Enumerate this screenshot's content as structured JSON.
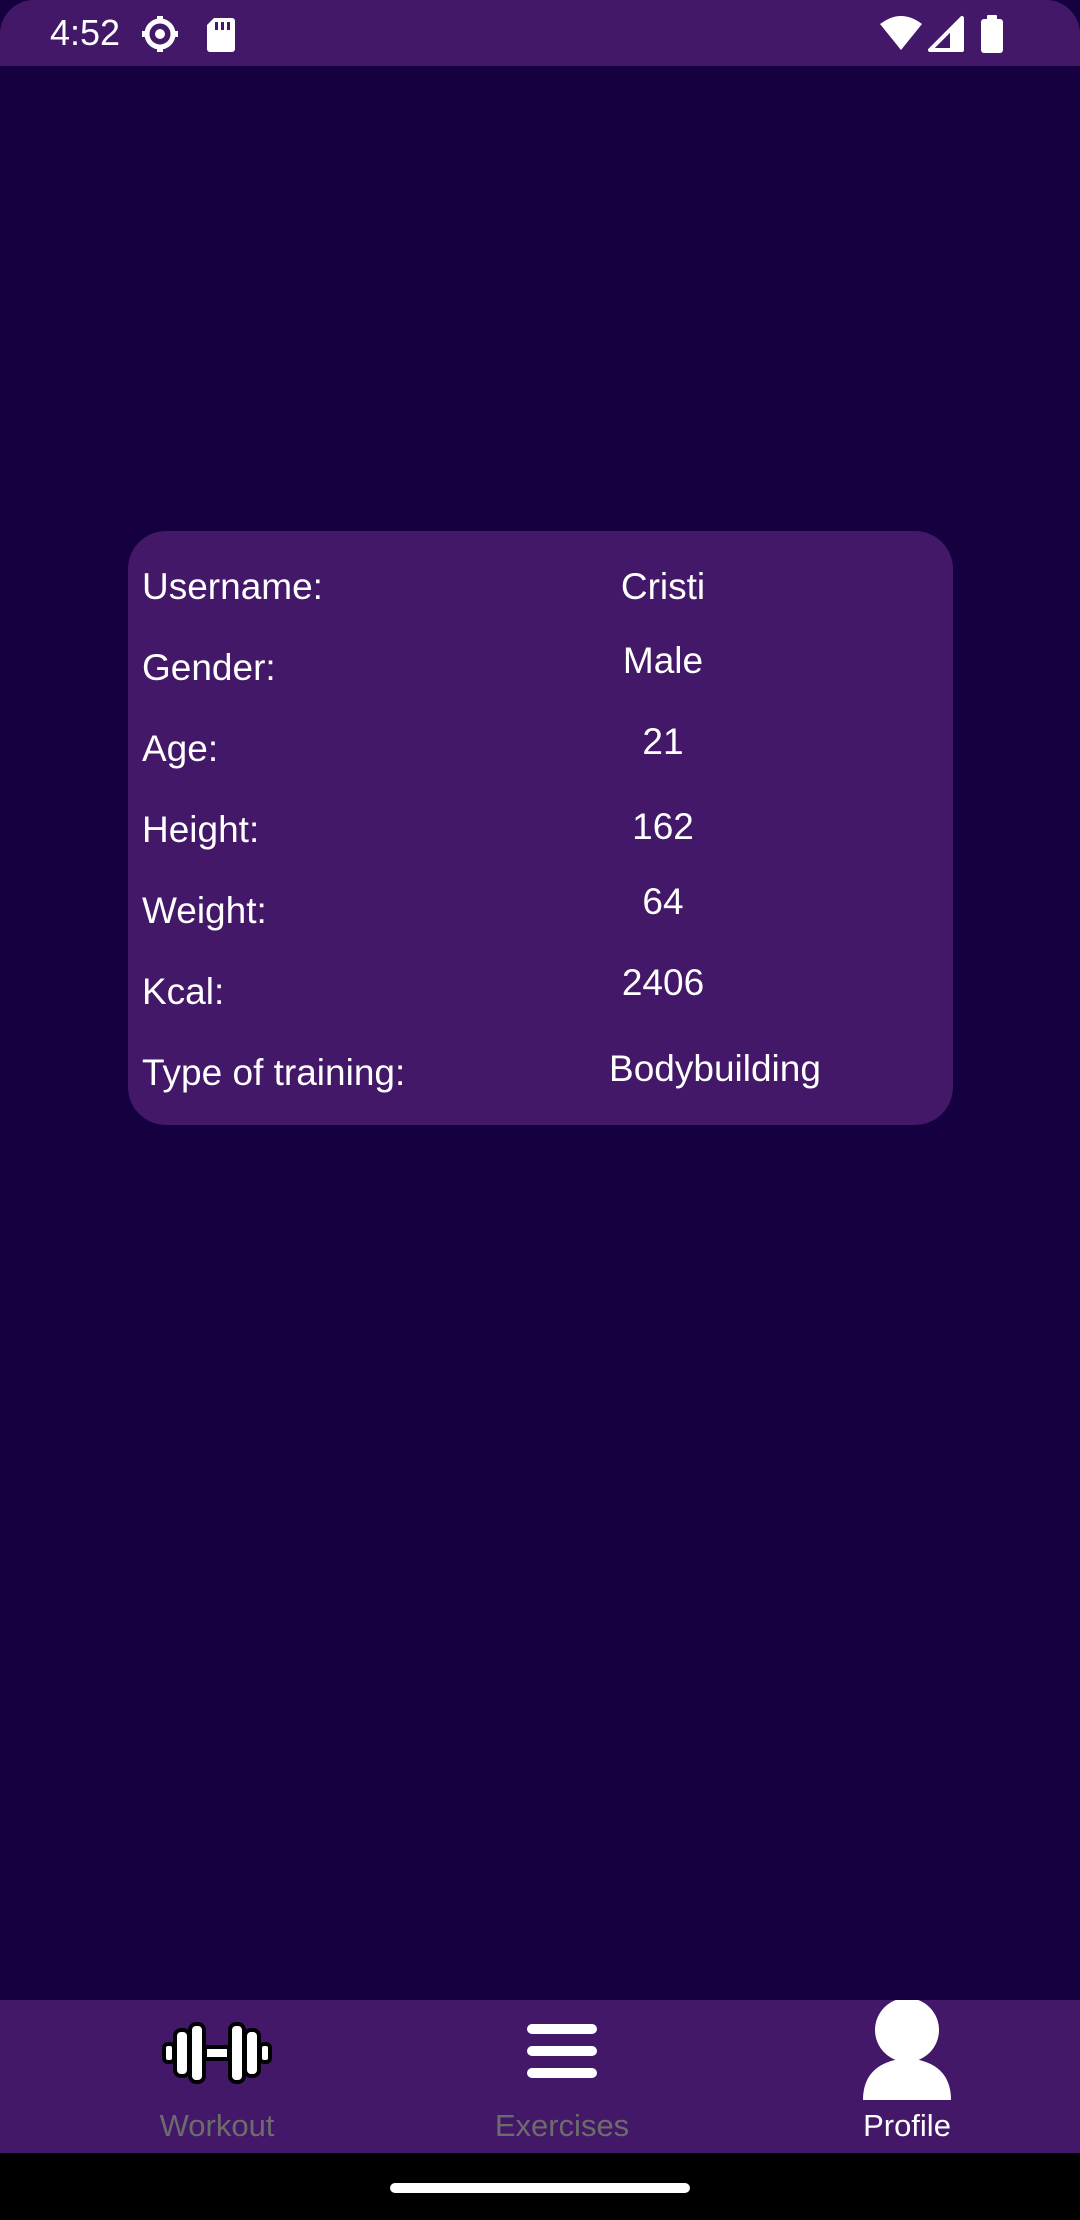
{
  "status_bar": {
    "time": "4:52",
    "left_icons": [
      "settings-gear-icon",
      "sd-card-icon"
    ],
    "right_icons": [
      "wifi-icon",
      "cell-signal-icon",
      "battery-icon"
    ]
  },
  "profile": {
    "rows": [
      {
        "label": "Username:",
        "value": "Cristi"
      },
      {
        "label": "Gender:",
        "value": "Male"
      },
      {
        "label": "Age:",
        "value": "21"
      },
      {
        "label": "Height:",
        "value": "162"
      },
      {
        "label": "Weight:",
        "value": "64"
      },
      {
        "label": "Kcal:",
        "value": "2406"
      },
      {
        "label": "Type of training:",
        "value": "Bodybuilding"
      }
    ]
  },
  "bottom_nav": {
    "items": [
      {
        "label": "Workout",
        "icon": "dumbbell-icon",
        "active": false
      },
      {
        "label": "Exercises",
        "icon": "menu-icon",
        "active": false
      },
      {
        "label": "Profile",
        "icon": "person-icon",
        "active": true
      }
    ]
  },
  "colors": {
    "background": "#150040",
    "surface": "#431868",
    "text": "#ffffff",
    "inactive_text": "#6c6c6c"
  }
}
